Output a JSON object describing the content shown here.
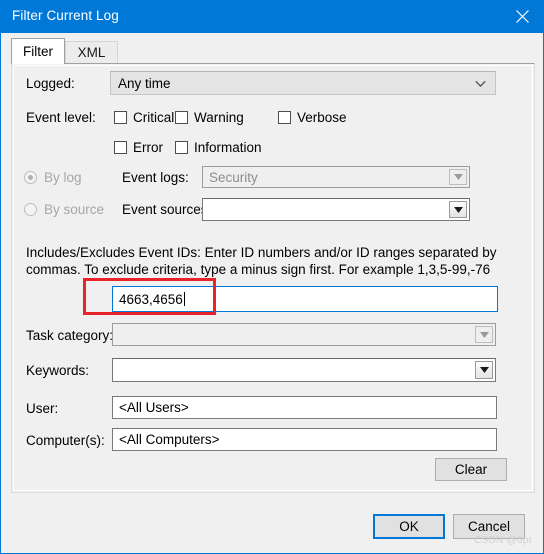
{
  "window": {
    "title": "Filter Current Log",
    "close_icon": "close-icon",
    "accent_color": "#0078d7",
    "background_color": "#f0f0f0"
  },
  "tabs": [
    {
      "label": "Filter",
      "active": true
    },
    {
      "label": "XML",
      "active": false
    }
  ],
  "form": {
    "logged": {
      "label": "Logged:",
      "value": "Any time",
      "enabled": true
    },
    "event_level": {
      "label": "Event level:",
      "options": [
        {
          "label": "Critical",
          "checked": false
        },
        {
          "label": "Warning",
          "checked": false
        },
        {
          "label": "Verbose",
          "checked": false
        },
        {
          "label": "Error",
          "checked": false
        },
        {
          "label": "Information",
          "checked": false
        }
      ]
    },
    "source_mode": {
      "by_log": {
        "label": "By log",
        "selected": true,
        "enabled": false
      },
      "by_source": {
        "label": "By source",
        "selected": false,
        "enabled": false
      }
    },
    "event_logs": {
      "label": "Event logs:",
      "value": "Security",
      "enabled": false
    },
    "event_sources": {
      "label": "Event sources:",
      "value": "",
      "enabled": true
    },
    "event_ids": {
      "hint": "Includes/Excludes Event IDs: Enter ID numbers and/or ID ranges separated by commas. To exclude criteria, type a minus sign first. For example 1,3,5-99,-76",
      "value": "4663,4656",
      "focused": true
    },
    "task_category": {
      "label": "Task category:",
      "value": "",
      "enabled": false
    },
    "keywords": {
      "label": "Keywords:",
      "value": "",
      "enabled": true
    },
    "user": {
      "label": "User:",
      "value": "<All Users>"
    },
    "computers": {
      "label": "Computer(s):",
      "value": "<All Computers>"
    }
  },
  "buttons": {
    "clear": "Clear",
    "ok": "OK",
    "cancel": "Cancel"
  },
  "annotation": {
    "color": "#e8232a",
    "target": "event-ids-input"
  },
  "watermark": "CSDN @0pr"
}
